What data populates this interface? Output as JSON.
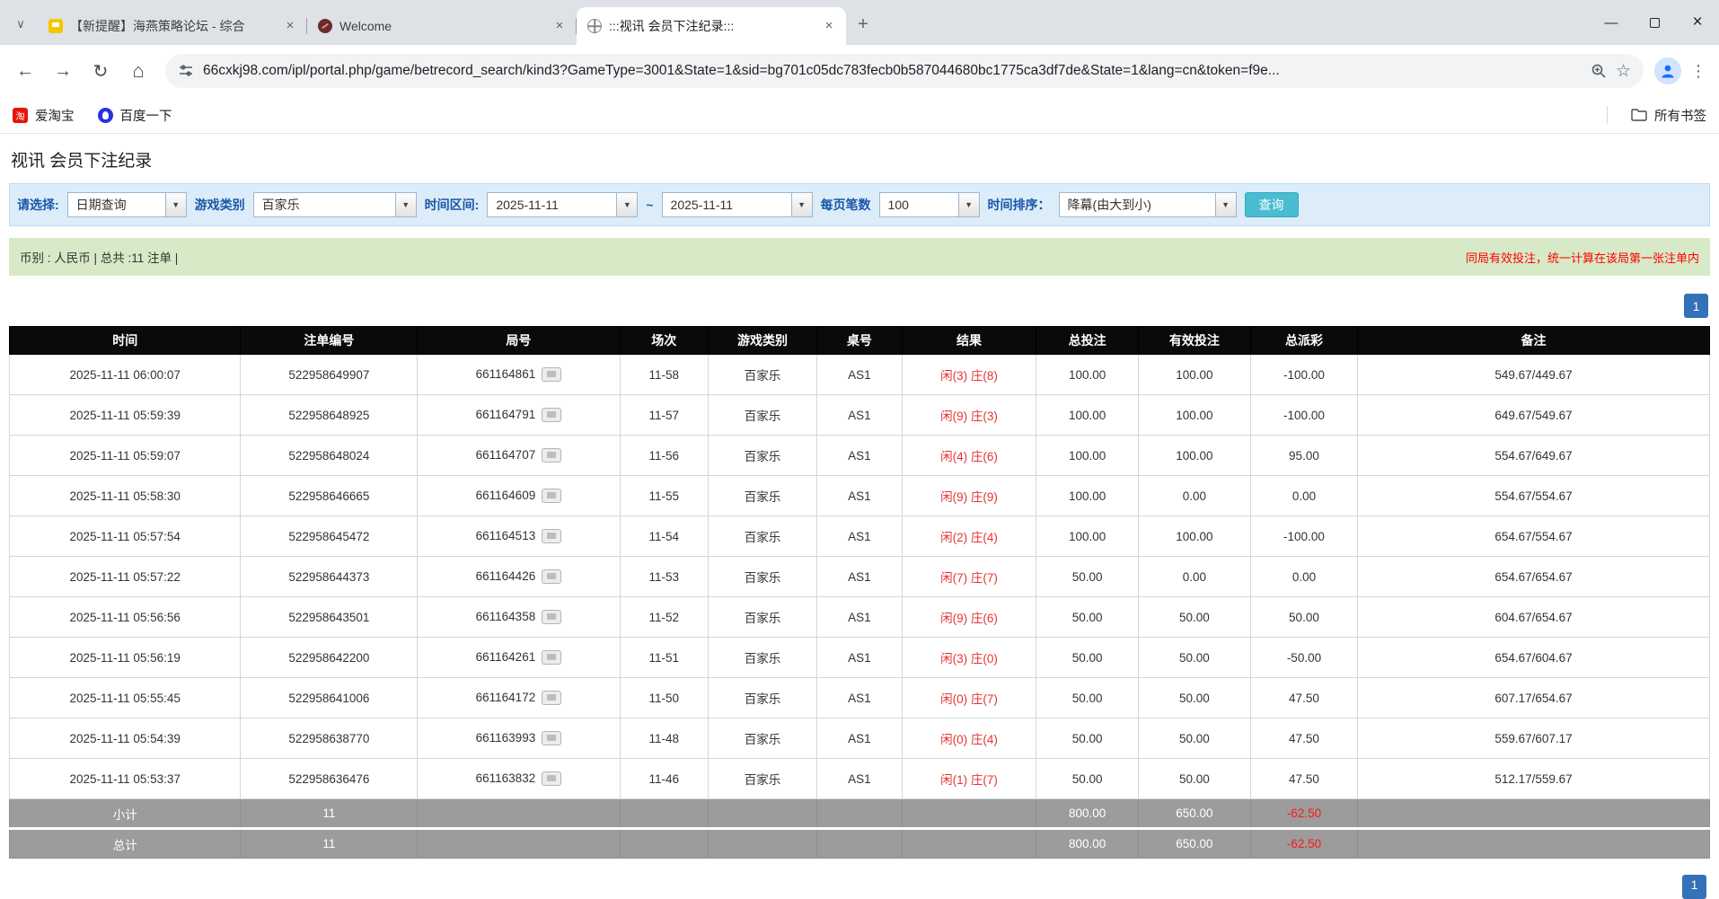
{
  "browser": {
    "tabs": [
      {
        "title": "【新提醒】海燕策略论坛 - 综合",
        "active": false
      },
      {
        "title": "Welcome",
        "active": false
      },
      {
        "title": ":::视讯 会员下注纪录:::",
        "active": true
      }
    ],
    "new_tab_label": "+",
    "window": {
      "minimize": "—",
      "close": "×"
    },
    "url": "66cxkj98.com/ipl/portal.php/game/betrecord_search/kind3?GameType=3001&State=1&sid=bg701c05dc783fecb0b587044680bc1775ca3df7de&State=1&lang=cn&token=f9e...",
    "bookmarks": [
      {
        "label": "爱淘宝",
        "icon_text": "淘"
      },
      {
        "label": "百度一下"
      }
    ],
    "all_bookmarks_label": "所有书签"
  },
  "page": {
    "title": "视讯 会员下注纪录",
    "filters": {
      "select_label": "请选择:",
      "select_value": "日期查询",
      "game_type_label": "游戏类别",
      "game_type_value": "百家乐",
      "range_label": "时间区间:",
      "date_from": "2025-11-11",
      "tilde": "~",
      "date_to": "2025-11-11",
      "per_page_label": "每页笔数",
      "per_page_value": "100",
      "sort_label": "时间排序：",
      "sort_value": "降幕(由大到小)",
      "search_button": "查询",
      "dropdown_arrow": "▼"
    },
    "info_bar": {
      "left": "币别 : 人民币 | 总共 :11 注单 |",
      "right": "同局有效投注，统一计算在该局第一张注单内"
    },
    "pagination": "1"
  },
  "table": {
    "headers": [
      "时间",
      "注单编号",
      "局号",
      "场次",
      "游戏类别",
      "桌号",
      "结果",
      "总投注",
      "有效投注",
      "总派彩",
      "备注"
    ],
    "rows": [
      {
        "time": "2025-11-11 06:00:07",
        "bet_id": "522958649907",
        "round": "661164861",
        "session": "11-58",
        "game": "百家乐",
        "table": "AS1",
        "xian": "闲(3)",
        "zhuang": "庄(8)",
        "total": "100.00",
        "valid": "100.00",
        "payout": "-100.00",
        "note": "549.67/449.67"
      },
      {
        "time": "2025-11-11 05:59:39",
        "bet_id": "522958648925",
        "round": "661164791",
        "session": "11-57",
        "game": "百家乐",
        "table": "AS1",
        "xian": "闲(9)",
        "zhuang": "庄(3)",
        "total": "100.00",
        "valid": "100.00",
        "payout": "-100.00",
        "note": "649.67/549.67"
      },
      {
        "time": "2025-11-11 05:59:07",
        "bet_id": "522958648024",
        "round": "661164707",
        "session": "11-56",
        "game": "百家乐",
        "table": "AS1",
        "xian": "闲(4)",
        "zhuang": "庄(6)",
        "total": "100.00",
        "valid": "100.00",
        "payout": "95.00",
        "note": "554.67/649.67"
      },
      {
        "time": "2025-11-11 05:58:30",
        "bet_id": "522958646665",
        "round": "661164609",
        "session": "11-55",
        "game": "百家乐",
        "table": "AS1",
        "xian": "闲(9)",
        "zhuang": "庄(9)",
        "total": "100.00",
        "valid": "0.00",
        "payout": "0.00",
        "note": "554.67/554.67"
      },
      {
        "time": "2025-11-11 05:57:54",
        "bet_id": "522958645472",
        "round": "661164513",
        "session": "11-54",
        "game": "百家乐",
        "table": "AS1",
        "xian": "闲(2)",
        "zhuang": "庄(4)",
        "total": "100.00",
        "valid": "100.00",
        "payout": "-100.00",
        "note": "654.67/554.67"
      },
      {
        "time": "2025-11-11 05:57:22",
        "bet_id": "522958644373",
        "round": "661164426",
        "session": "11-53",
        "game": "百家乐",
        "table": "AS1",
        "xian": "闲(7)",
        "zhuang": "庄(7)",
        "total": "50.00",
        "valid": "0.00",
        "payout": "0.00",
        "note": "654.67/654.67"
      },
      {
        "time": "2025-11-11 05:56:56",
        "bet_id": "522958643501",
        "round": "661164358",
        "session": "11-52",
        "game": "百家乐",
        "table": "AS1",
        "xian": "闲(9)",
        "zhuang": "庄(6)",
        "total": "50.00",
        "valid": "50.00",
        "payout": "50.00",
        "note": "604.67/654.67"
      },
      {
        "time": "2025-11-11 05:56:19",
        "bet_id": "522958642200",
        "round": "661164261",
        "session": "11-51",
        "game": "百家乐",
        "table": "AS1",
        "xian": "闲(3)",
        "zhuang": "庄(0)",
        "total": "50.00",
        "valid": "50.00",
        "payout": "-50.00",
        "note": "654.67/604.67"
      },
      {
        "time": "2025-11-11 05:55:45",
        "bet_id": "522958641006",
        "round": "661164172",
        "session": "11-50",
        "game": "百家乐",
        "table": "AS1",
        "xian": "闲(0)",
        "zhuang": "庄(7)",
        "total": "50.00",
        "valid": "50.00",
        "payout": "47.50",
        "note": "607.17/654.67"
      },
      {
        "time": "2025-11-11 05:54:39",
        "bet_id": "522958638770",
        "round": "661163993",
        "session": "11-48",
        "game": "百家乐",
        "table": "AS1",
        "xian": "闲(0)",
        "zhuang": "庄(4)",
        "total": "50.00",
        "valid": "50.00",
        "payout": "47.50",
        "note": "559.67/607.17"
      },
      {
        "time": "2025-11-11 05:53:37",
        "bet_id": "522958636476",
        "round": "661163832",
        "session": "11-46",
        "game": "百家乐",
        "table": "AS1",
        "xian": "闲(1)",
        "zhuang": "庄(7)",
        "total": "50.00",
        "valid": "50.00",
        "payout": "47.50",
        "note": "512.17/559.67"
      }
    ],
    "footers": [
      {
        "label": "小计",
        "count": "11",
        "total_bet": "800.00",
        "valid_bet": "650.00",
        "payout": "-62.50"
      },
      {
        "label": "总计",
        "count": "11",
        "total_bet": "800.00",
        "valid_bet": "650.00",
        "payout": "-62.50"
      }
    ]
  }
}
